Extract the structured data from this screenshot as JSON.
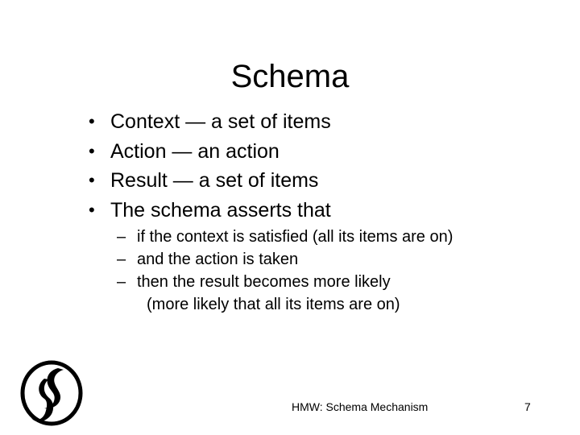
{
  "slide": {
    "title": "Schema",
    "bullet_symbol": "•",
    "sub_bullet_symbol": "–",
    "bullets": [
      {
        "text": "Context — a set of items"
      },
      {
        "text": "Action — an action"
      },
      {
        "text": "Result — a set of items"
      },
      {
        "text": "The schema asserts that",
        "sub_bullets": [
          {
            "text": "if the context is satisfied (all its items are on)"
          },
          {
            "text": "and the action is taken"
          },
          {
            "text": "then the result becomes more likely",
            "continuation": "(more likely that all its items are on)"
          }
        ]
      }
    ],
    "footer": {
      "label": "HMW: Schema Mechanism",
      "page_number": "7"
    },
    "logo_icon": "stylized-s-logo-icon"
  }
}
